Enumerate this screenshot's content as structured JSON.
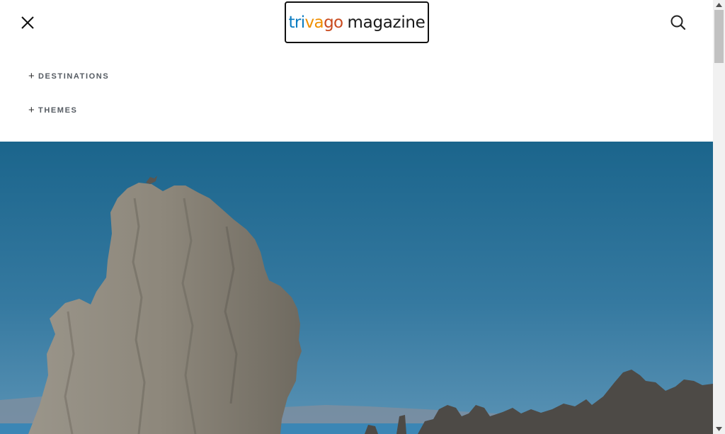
{
  "header": {
    "logo": {
      "part1": "tri",
      "part2": "va",
      "part3": "go",
      "suffix": "magazine"
    },
    "icons": {
      "close": "close-icon",
      "search": "search-icon"
    }
  },
  "menu": {
    "items": [
      {
        "prefix": "+",
        "label": "DESTINATIONS"
      },
      {
        "prefix": "+",
        "label": "THEMES"
      }
    ]
  },
  "hero": {
    "image": "tufa-towers-lake-photo"
  },
  "colors": {
    "logo_blue": "#0a7bc1",
    "logo_orange": "#f09000",
    "logo_red": "#c94a1e",
    "sky": "#1f6d93",
    "menu_text": "#555b62"
  }
}
